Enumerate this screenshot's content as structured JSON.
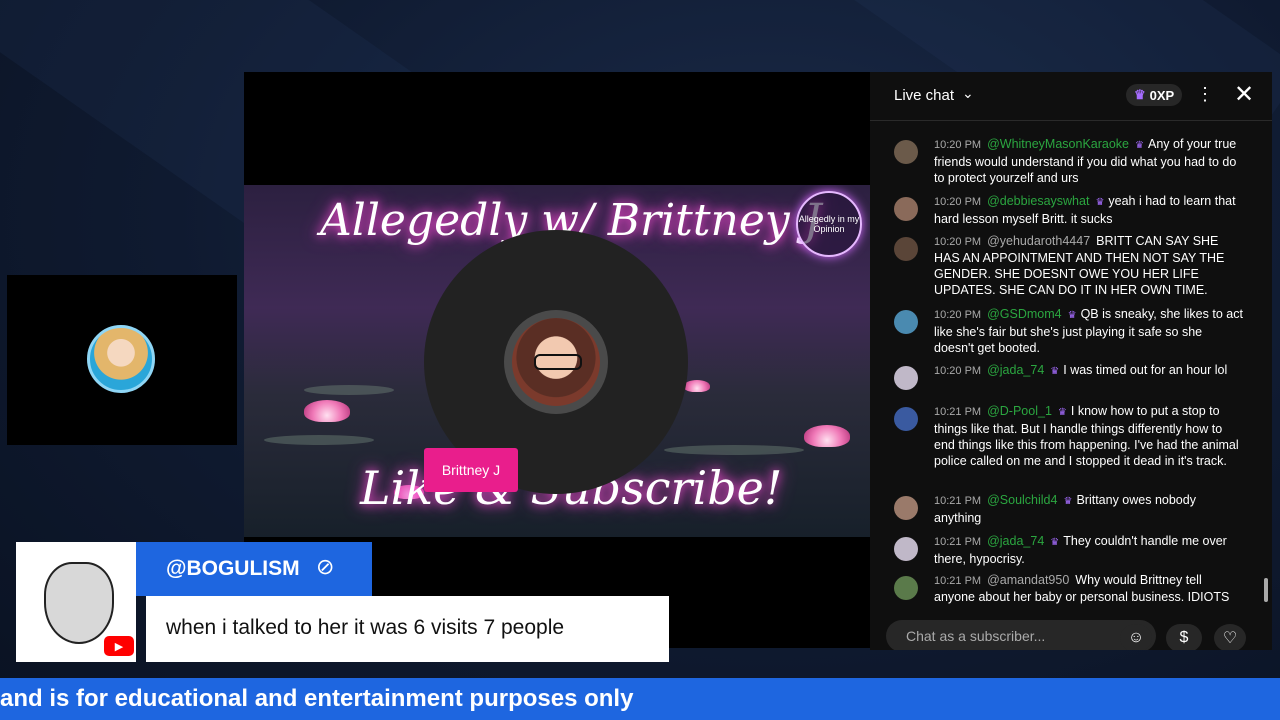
{
  "stream": {
    "banner_title": "Allegedly w/ Brittney J",
    "banner_subtitle": "Like & Subscribe!",
    "banner_badge": "Allegedly in my Opinion",
    "speaker_name": "Brittney J"
  },
  "chat": {
    "title": "Live chat",
    "xp": "0XP",
    "input_placeholder": "Chat as a subscriber...",
    "messages": [
      {
        "time": "10:20 PM",
        "user": "@WhitneyMasonKaraoke",
        "text": "Any of your true friends would understand if you did what you had to do to protect yourzelf and urs",
        "member": true
      },
      {
        "time": "10:20 PM",
        "user": "@debbiesayswhat",
        "text": "yeah i had to learn that hard lesson myself Britt. it sucks",
        "member": true
      },
      {
        "time": "10:20 PM",
        "user": "@yehudaroth4447",
        "text": "BRITT CAN SAY SHE HAS AN APPOINTMENT AND THEN NOT SAY THE GENDER. SHE DOESNT OWE YOU HER LIFE UPDATES. SHE CAN DO IT IN HER OWN TIME.",
        "member": false
      },
      {
        "time": "10:20 PM",
        "user": "@GSDmom4",
        "text": "QB is sneaky, she likes to act like she's fair but she's just playing it safe so she doesn't get booted.",
        "member": true
      },
      {
        "time": "10:20 PM",
        "user": "@jada_74",
        "text": "I was timed out for an hour lol",
        "member": true
      },
      {
        "time": "10:21 PM",
        "user": "@D-Pool_1",
        "text": "I know how to put a stop to things like that. But I handle things differently how to end things like this from happening. I've had the animal police called on me and I stopped it dead in it's track.",
        "member": true
      },
      {
        "time": "10:21 PM",
        "user": "@Soulchild4",
        "text": "Brittany owes nobody anything",
        "member": true
      },
      {
        "time": "10:21 PM",
        "user": "@jada_74",
        "text": "They couldn't handle me over there, hypocrisy.",
        "member": true
      },
      {
        "time": "10:21 PM",
        "user": "@amandat950",
        "text": "Why would Brittney tell anyone about her baby or personal business. IDIOTS",
        "member": false
      }
    ]
  },
  "comment": {
    "user": "@BOGULISM",
    "text": "when i talked to her it was 6 visits 7 people"
  },
  "ticker": {
    "text": "and is for educational and entertainment purposes only"
  },
  "colors": {
    "accent": "#1e66e0",
    "speaker_tag": "#e91e8c",
    "member_name": "#2ba640",
    "chat_bg": "#0f0f0f"
  },
  "icons": {
    "more": "more-vert-icon",
    "close": "close-icon",
    "emoji": "emoji-icon",
    "super_chat": "super-chat-icon",
    "heart": "heart-icon"
  }
}
